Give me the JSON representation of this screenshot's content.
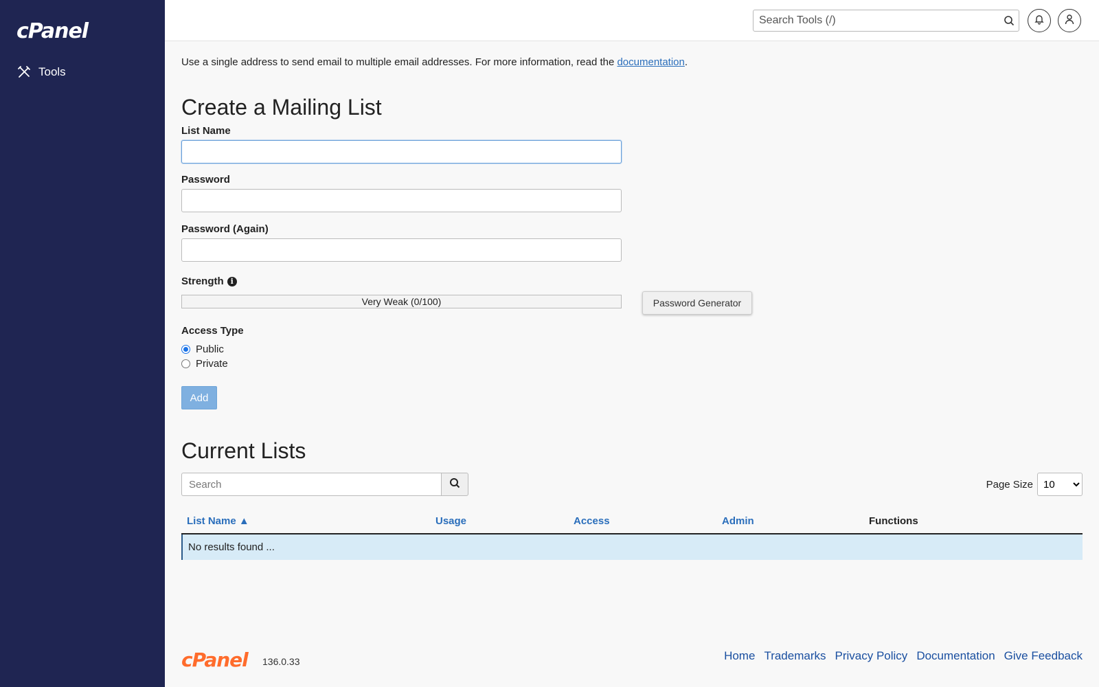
{
  "sidebar": {
    "logo": "cPanel",
    "items": [
      {
        "label": "Tools",
        "icon": "tools-icon"
      }
    ]
  },
  "topbar": {
    "search_placeholder": "Search Tools (/)"
  },
  "intro": {
    "text_before": "Use a single address to send email to multiple email addresses. For more information, read the ",
    "link_text": "documentation",
    "text_after": "."
  },
  "create_form": {
    "title": "Create a Mailing List",
    "list_name_label": "List Name",
    "list_name_value": "",
    "password_label": "Password",
    "password_value": "",
    "password_again_label": "Password (Again)",
    "password_again_value": "",
    "strength_label": "Strength",
    "strength_text": "Very Weak (0/100)",
    "strength_value": 0,
    "password_generator_label": "Password Generator",
    "access_type_label": "Access Type",
    "access_options": [
      {
        "label": "Public",
        "checked": true
      },
      {
        "label": "Private",
        "checked": false
      }
    ],
    "add_label": "Add"
  },
  "current_lists": {
    "title": "Current Lists",
    "search_placeholder": "Search",
    "page_size_label": "Page Size",
    "page_size_value": "10",
    "columns": [
      "List Name ▲",
      "Usage",
      "Access",
      "Admin",
      "Functions"
    ],
    "empty_message": "No results found ..."
  },
  "footer": {
    "logo": "cPanel",
    "version": "136.0.33",
    "links": [
      "Home",
      "Trademarks",
      "Privacy Policy",
      "Documentation",
      "Give Feedback"
    ]
  },
  "colors": {
    "sidebar_bg": "#1f2552",
    "link": "#2a6ebb",
    "footer_logo": "#ff6c2c",
    "add_button": "#7fb0e0",
    "no_results_bg": "#d7ebf7"
  }
}
